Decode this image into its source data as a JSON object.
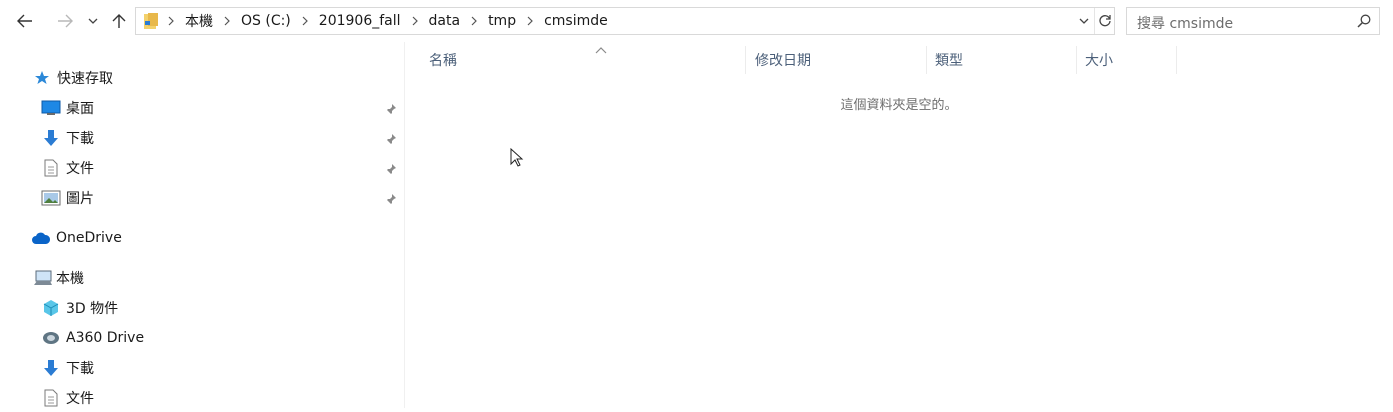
{
  "nav": {
    "back_icon": "arrow-left-icon",
    "forward_icon": "arrow-right-icon",
    "recent_icon": "chevron-down-icon",
    "up_icon": "arrow-up-icon"
  },
  "address": {
    "crumbs": [
      "本機",
      "OS (C:)",
      "201906_fall",
      "data",
      "tmp",
      "cmsimde"
    ]
  },
  "search": {
    "placeholder": "搜尋 cmsimde"
  },
  "sidebar": {
    "quick_access": "快速存取",
    "pinned": [
      {
        "label": "桌面",
        "icon": "desktop-icon"
      },
      {
        "label": "下載",
        "icon": "download-icon"
      },
      {
        "label": "文件",
        "icon": "document-icon"
      },
      {
        "label": "圖片",
        "icon": "pictures-icon"
      }
    ],
    "onedrive": "OneDrive",
    "this_pc": "本機",
    "pc_items": [
      {
        "label": "3D 物件",
        "icon": "3d-objects-icon"
      },
      {
        "label": "A360 Drive",
        "icon": "a360-drive-icon"
      },
      {
        "label": "下載",
        "icon": "download-icon"
      },
      {
        "label": "文件",
        "icon": "document-icon"
      }
    ]
  },
  "columns": {
    "name": "名稱",
    "date": "修改日期",
    "type": "類型",
    "size": "大小"
  },
  "empty_message": "這個資料夾是空的。",
  "colors": {
    "header_text": "#4c607a",
    "accent": "#0078d7",
    "folder": "#e8b84a"
  }
}
